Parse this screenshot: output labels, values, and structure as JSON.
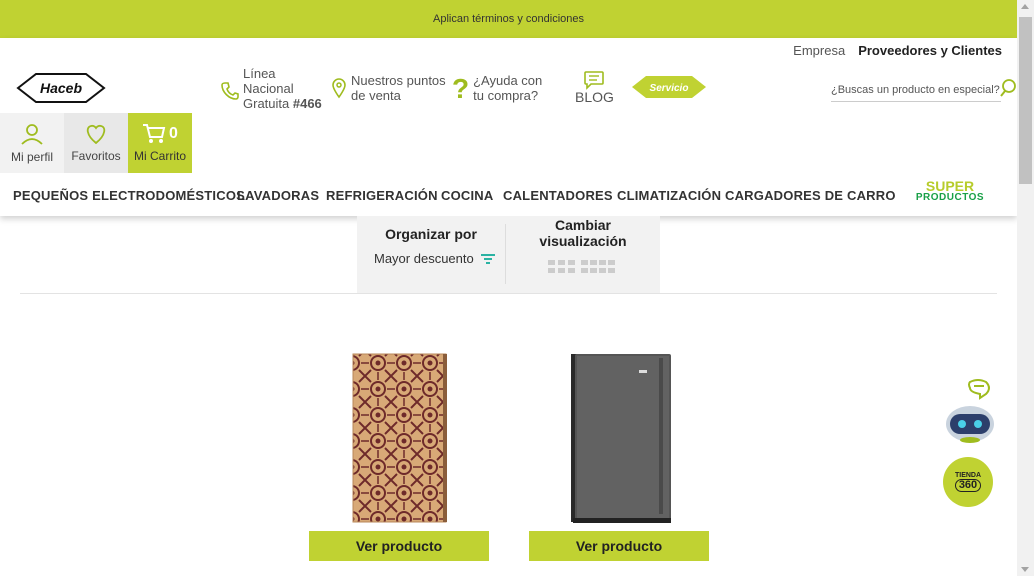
{
  "topbar": {
    "text": "Aplican términos y condiciones"
  },
  "header": {
    "links": {
      "empresa": "Empresa",
      "proveedores": "Proveedores y Clientes"
    },
    "logo": {
      "text": "Haceb"
    },
    "linea": {
      "line1": "Línea",
      "line2": "Nacional",
      "line3": "Gratuita ",
      "number": "#466"
    },
    "puntos": {
      "line1": "Nuestros puntos",
      "line2": "de venta"
    },
    "ayuda": {
      "icon": "?",
      "line1": "¿Ayuda con",
      "line2": "tu compra?"
    },
    "blog": {
      "label": "BLOG"
    },
    "servicio": {
      "label": "Servicio"
    },
    "search": {
      "placeholder": "¿Buscas un producto en especial?"
    }
  },
  "account": {
    "perfil": "Mi perfil",
    "favoritos": "Favoritos",
    "carrito": "Mi Carrito",
    "cart_count": "0"
  },
  "nav": {
    "items": [
      "PEQUEÑOS ELECTRODOMÉSTICOS",
      "LAVADORAS",
      "REFRIGERACIÓN",
      "COCINA",
      "CALENTADORES",
      "CLIMATIZACIÓN",
      "CARGADORES DE CARRO"
    ],
    "super_line1": "SUPER",
    "super_line2": "PRODUCTOS"
  },
  "sort": {
    "title": "Organizar por",
    "value": "Mayor descuento",
    "view_title_line1": "Cambiar",
    "view_title_line2": "visualización"
  },
  "products": [
    {
      "button": "Ver producto",
      "image": "patterned-minibar-fridge"
    },
    {
      "button": "Ver producto",
      "image": "gray-minibar-fridge"
    }
  ],
  "widgets": {
    "tienda_line1": "TIENDA",
    "tienda_line2": "360"
  },
  "colors": {
    "brand_green": "#c0d232",
    "accent_teal": "#2bb3a3",
    "dark_green": "#19a047"
  }
}
